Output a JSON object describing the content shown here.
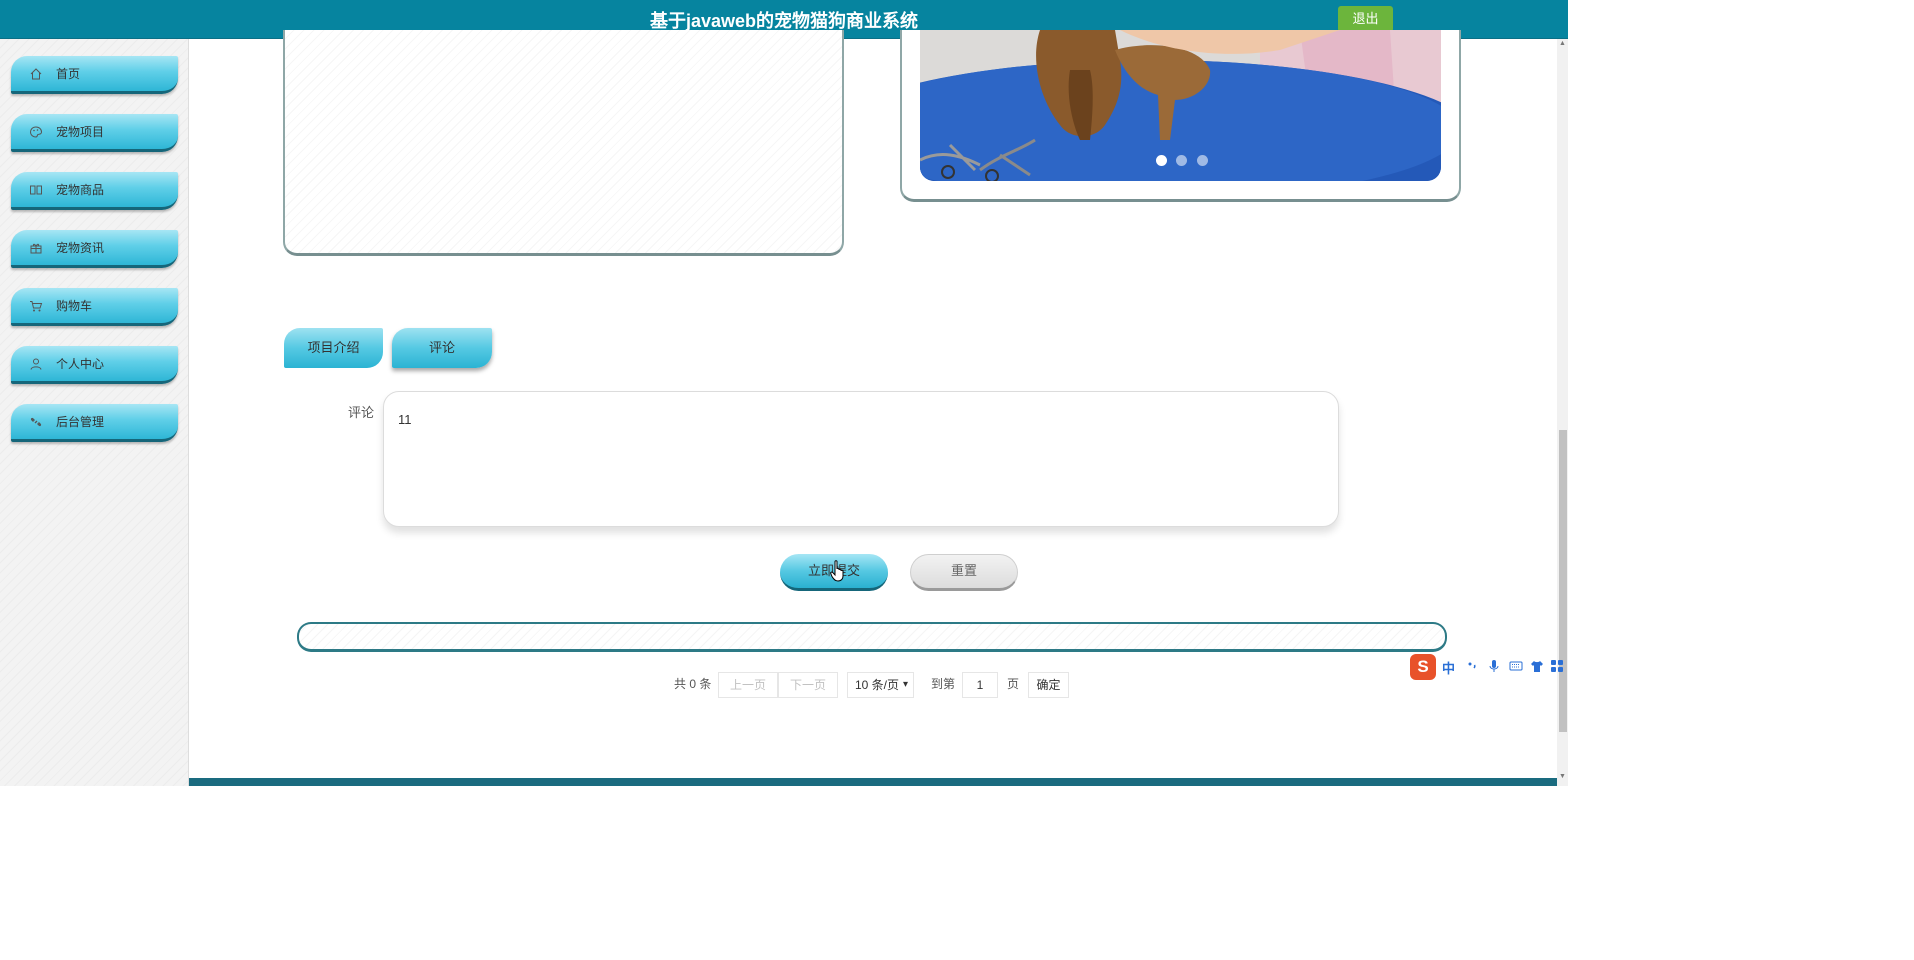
{
  "header": {
    "title": "基于javaweb的宠物猫狗商业系统",
    "logout_label": "退出"
  },
  "sidebar": {
    "items": [
      {
        "label": "首页",
        "icon": "home-icon"
      },
      {
        "label": "宠物项目",
        "icon": "palette-icon"
      },
      {
        "label": "宠物商品",
        "icon": "book-icon"
      },
      {
        "label": "宠物资讯",
        "icon": "gift-icon"
      },
      {
        "label": "购物车",
        "icon": "cart-icon"
      },
      {
        "label": "个人中心",
        "icon": "user-icon"
      },
      {
        "label": "后台管理",
        "icon": "link-icon"
      }
    ]
  },
  "carousel": {
    "slide_count": 3,
    "active_slide": 1
  },
  "tabs": {
    "intro_label": "项目介绍",
    "comment_label": "评论",
    "active": "评论"
  },
  "comment_form": {
    "label": "评论",
    "value": "11",
    "submit_label": "立即提交",
    "reset_label": "重置"
  },
  "pagination": {
    "total_text": "共 0 条",
    "prev_label": "上一页",
    "next_label": "下一页",
    "page_size_label": "10 条/页",
    "goto_label": "到第",
    "page_value": "1",
    "page_suffix": "页",
    "confirm_label": "确定"
  },
  "ime": {
    "logo": "S",
    "lang": "中"
  },
  "colors": {
    "header_bg": "#06849f",
    "logout_bg": "#6cb53c",
    "nav_accent": "#2eb6d6"
  }
}
